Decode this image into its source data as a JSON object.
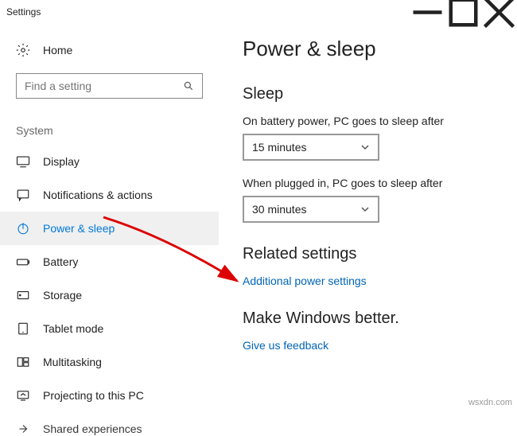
{
  "window": {
    "title": "Settings"
  },
  "sidebar": {
    "home_label": "Home",
    "search_placeholder": "Find a setting",
    "section_label": "System",
    "items": [
      {
        "label": "Display"
      },
      {
        "label": "Notifications & actions"
      },
      {
        "label": "Power & sleep"
      },
      {
        "label": "Battery"
      },
      {
        "label": "Storage"
      },
      {
        "label": "Tablet mode"
      },
      {
        "label": "Multitasking"
      },
      {
        "label": "Projecting to this PC"
      },
      {
        "label": "Shared experiences"
      }
    ]
  },
  "main": {
    "title": "Power & sleep",
    "sleep": {
      "heading": "Sleep",
      "battery_label": "On battery power, PC goes to sleep after",
      "battery_value": "15 minutes",
      "plugged_label": "When plugged in, PC goes to sleep after",
      "plugged_value": "30 minutes"
    },
    "related": {
      "heading": "Related settings",
      "link": "Additional power settings"
    },
    "better": {
      "heading": "Make Windows better.",
      "link": "Give us feedback"
    }
  },
  "watermark": "wsxdn.com"
}
